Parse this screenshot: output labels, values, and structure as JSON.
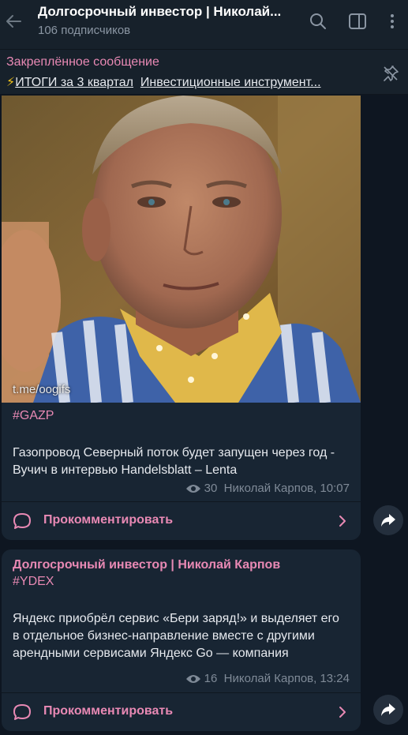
{
  "header": {
    "title": "Долгосрочный инвестор | Николай...",
    "subscribers": "106 подписчиков"
  },
  "pinned": {
    "label": "Закреплённое сообщение",
    "emoji": "⚡",
    "link1": "ИТОГИ за 3 квартал",
    "link2": "Инвестиционные инструмент..."
  },
  "posts": [
    {
      "media_watermark": "t.me/oogifs",
      "tag": "#GAZP",
      "text": "Газопровод Северный поток будет запущен через год  - Вучич в интервью Handelsblatt – Lenta",
      "views": "30",
      "author_time": "Николай Карпов, 10:07",
      "comment_label": "Прокомментировать"
    },
    {
      "author": "Долгосрочный инвестор | Николай Карпов",
      "tag": "#YDEX",
      "text": "Яндекс приобрёл сервис «Бери заряд!» и выделяет его в отдельное бизнес-направление вместе с другими арендными сервисами Яндекс Go — компания",
      "views": "16",
      "author_time": "Николай Карпов, 13:24",
      "comment_label": "Прокомментировать"
    }
  ],
  "icons": {
    "back": "arrow-left-icon",
    "search": "search-icon",
    "sidebar": "sidebar-toggle-icon",
    "more": "more-vertical-icon",
    "unpin": "unpin-icon",
    "views": "eye-icon",
    "comment": "comment-bubble-icon",
    "chevron": "chevron-right-icon",
    "share": "share-arrow-icon"
  },
  "colors": {
    "accent": "#e889b4",
    "background": "#0e1621",
    "header": "#17212b",
    "bubble": "#182533"
  }
}
